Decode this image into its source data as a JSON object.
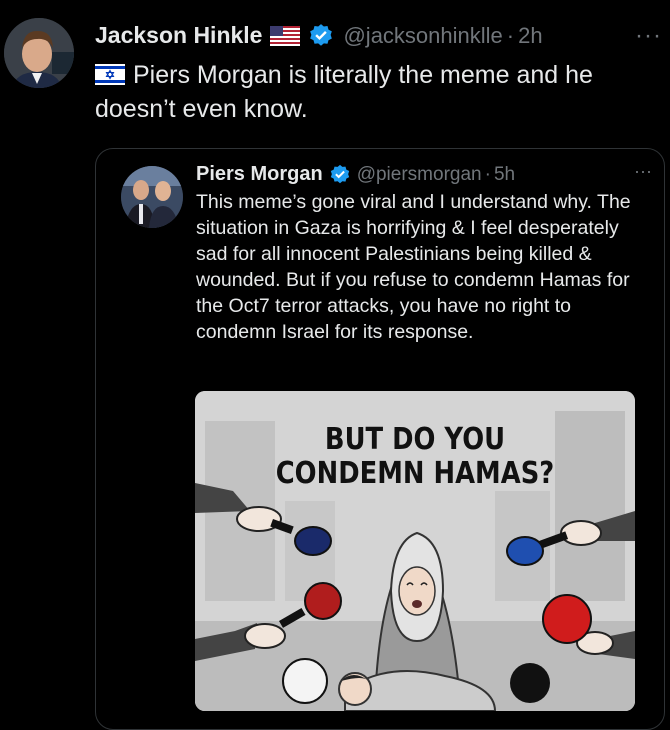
{
  "post": {
    "author_name": "Jackson Hinkle",
    "author_handle": "@jacksonhinklle",
    "separator": "·",
    "time": "2h",
    "more": "···",
    "text": "Piers Morgan is literally the meme and he doesn’t even know."
  },
  "quoted_post": {
    "author_name": "Piers Morgan",
    "author_handle": "@piersmorgan",
    "separator": "·",
    "time": "5h",
    "more": "···",
    "text": "This meme’s gone viral and I understand why. The situation in Gaza is horrifying & I feel desperately sad for all innocent Palestinians being killed & wounded. But if you refuse to condemn Hamas for the Oct7 terror attacks, you have no right to condemn Israel for its response.",
    "media": {
      "caption_line1": "BUT DO YOU",
      "caption_line2": "CONDEMN HAMAS?"
    }
  },
  "colors": {
    "background": "#000000",
    "text": "#e7e9ea",
    "secondary": "#71767b",
    "verified": "#1d9bf0",
    "border": "#2f3336"
  }
}
